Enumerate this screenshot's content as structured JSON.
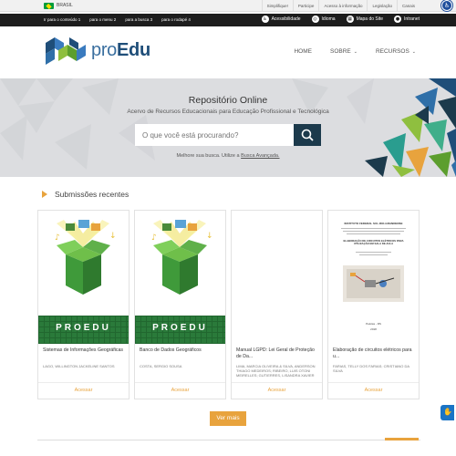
{
  "gov_bar": {
    "country": "BRASIL",
    "links": [
      "Simplifique!",
      "Participe",
      "Acesso à informação",
      "Legislação",
      "Canais"
    ]
  },
  "access_bar": {
    "skip_links": [
      "Ir para o conteúdo 1",
      "para o menu 2",
      "para a busca 3",
      "para o rodapé 4"
    ],
    "items": [
      {
        "label": "Acessibilidade",
        "icon": "accessibility-icon"
      },
      {
        "label": "Idioma",
        "icon": "globe-icon"
      },
      {
        "label": "Mapa do Site",
        "icon": "sitemap-icon"
      },
      {
        "label": "Intranet",
        "icon": "intranet-icon"
      }
    ]
  },
  "header": {
    "logo_light": "pro",
    "logo_bold": "Edu",
    "nav": [
      {
        "label": "HOME"
      },
      {
        "label": "SOBRE",
        "dropdown": true
      },
      {
        "label": "RECURSOS",
        "dropdown": true
      }
    ]
  },
  "hero": {
    "title": "Repositório Online",
    "subtitle": "Acervo de Recursos Educacionais para Educação Profissional e Tecnológica",
    "search_placeholder": "O que você está procurando?",
    "hint_prefix": "Melhore sua busca. Utilize a ",
    "hint_link": "Busca Avançada."
  },
  "recent": {
    "title": "Submissões recentes",
    "access_label": "Acessar",
    "cards": [
      {
        "title": "Sistemas de Informações Geográficas",
        "author": "LAGO, WILLINGTON JACKELINE SANTOS",
        "thumb": "proedu"
      },
      {
        "title": "Banco de Dados Geográficos",
        "author": "COSTA, SERGIO SOUSA",
        "thumb": "proedu"
      },
      {
        "title": "Manual LGPD: Lei Geral de Proteção de Da...",
        "author": "LIMA, MARCIA OLIVEIRA & SILVA, ANDERSON THIAGO MEDEIROS; RIBEIRO, LUIS OTONI MEIRELLES; GUTIERRES, LISANDRA XAVIER",
        "thumb": "blank"
      },
      {
        "title": "Elaboração de circuitos elétricos para u...",
        "author": "FARIAS, TELLY DOS FARIAS; CRISTIANO DA SILVA",
        "thumb": "document"
      }
    ],
    "doc_preview": {
      "institution": "INSTITUTO FEDERAL SUL-RIO-GRANDENSE",
      "heading": "ELABORAÇÃO DE CIRCUITOS ELÉTRICOS PARA UTILIZAÇÃO EM SALA DE AULA",
      "location": "Pelotas - RS",
      "year": "2018"
    },
    "proedu_label": "PROEDU"
  },
  "more_button": "Ver mais",
  "colors": {
    "accent": "#e8a33d",
    "brand": "#1f4e79",
    "search_button": "#1c3a4c",
    "topbar": "#1d1d1d"
  }
}
